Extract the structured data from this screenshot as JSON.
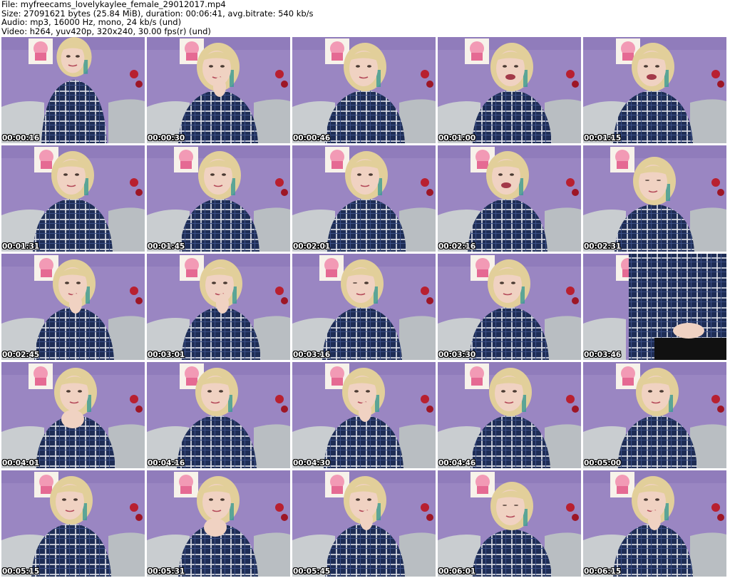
{
  "header": {
    "file_line": "File: myfreecams_lovelykaylee_female_29012017.mp4",
    "size_line": "Size: 27091621 bytes (25.84 MiB), duration: 00:06:41, avg.bitrate: 540 kb/s",
    "audio_line": "Audio: mp3, 16000 Hz, mono, 24 kb/s (und)",
    "video_line": "Video: h264, yuv420p, 320x240, 30.00 fps(r) (und)"
  },
  "colors": {
    "wall": "#9a86c2",
    "wall_dark": "#8672b4",
    "couch": "#c9cdd0",
    "shirt": "#1e2d55",
    "hair": "#e2cf9a",
    "skin": "#f0d2c2",
    "cupcake": "#f29ab5"
  },
  "thumbnails": [
    {
      "timestamp": "00:00:16",
      "variant": "sit-far"
    },
    {
      "timestamp": "00:00:30",
      "variant": "hand-lip"
    },
    {
      "timestamp": "00:00:46",
      "variant": "smile"
    },
    {
      "timestamp": "00:01:00",
      "variant": "talk"
    },
    {
      "timestamp": "00:01:15",
      "variant": "grin"
    },
    {
      "timestamp": "00:01:31",
      "variant": "plain"
    },
    {
      "timestamp": "00:01:45",
      "variant": "tilt"
    },
    {
      "timestamp": "00:02:01",
      "variant": "smile"
    },
    {
      "timestamp": "00:02:16",
      "variant": "laugh"
    },
    {
      "timestamp": "00:02:31",
      "variant": "down"
    },
    {
      "timestamp": "00:02:45",
      "variant": "hand-lip"
    },
    {
      "timestamp": "00:03:01",
      "variant": "hand-lip"
    },
    {
      "timestamp": "00:03:16",
      "variant": "wink"
    },
    {
      "timestamp": "00:03:30",
      "variant": "tilt"
    },
    {
      "timestamp": "00:03:46",
      "variant": "close-shirt"
    },
    {
      "timestamp": "00:04:01",
      "variant": "hands-clasped"
    },
    {
      "timestamp": "00:04:16",
      "variant": "plain"
    },
    {
      "timestamp": "00:04:30",
      "variant": "hand-lip"
    },
    {
      "timestamp": "00:04:46",
      "variant": "smile"
    },
    {
      "timestamp": "00:05:00",
      "variant": "plain"
    },
    {
      "timestamp": "00:05:15",
      "variant": "plain"
    },
    {
      "timestamp": "00:05:31",
      "variant": "hands-clasped"
    },
    {
      "timestamp": "00:05:45",
      "variant": "hand-lip"
    },
    {
      "timestamp": "00:06:01",
      "variant": "down"
    },
    {
      "timestamp": "00:06:15",
      "variant": "hand-lip"
    }
  ]
}
